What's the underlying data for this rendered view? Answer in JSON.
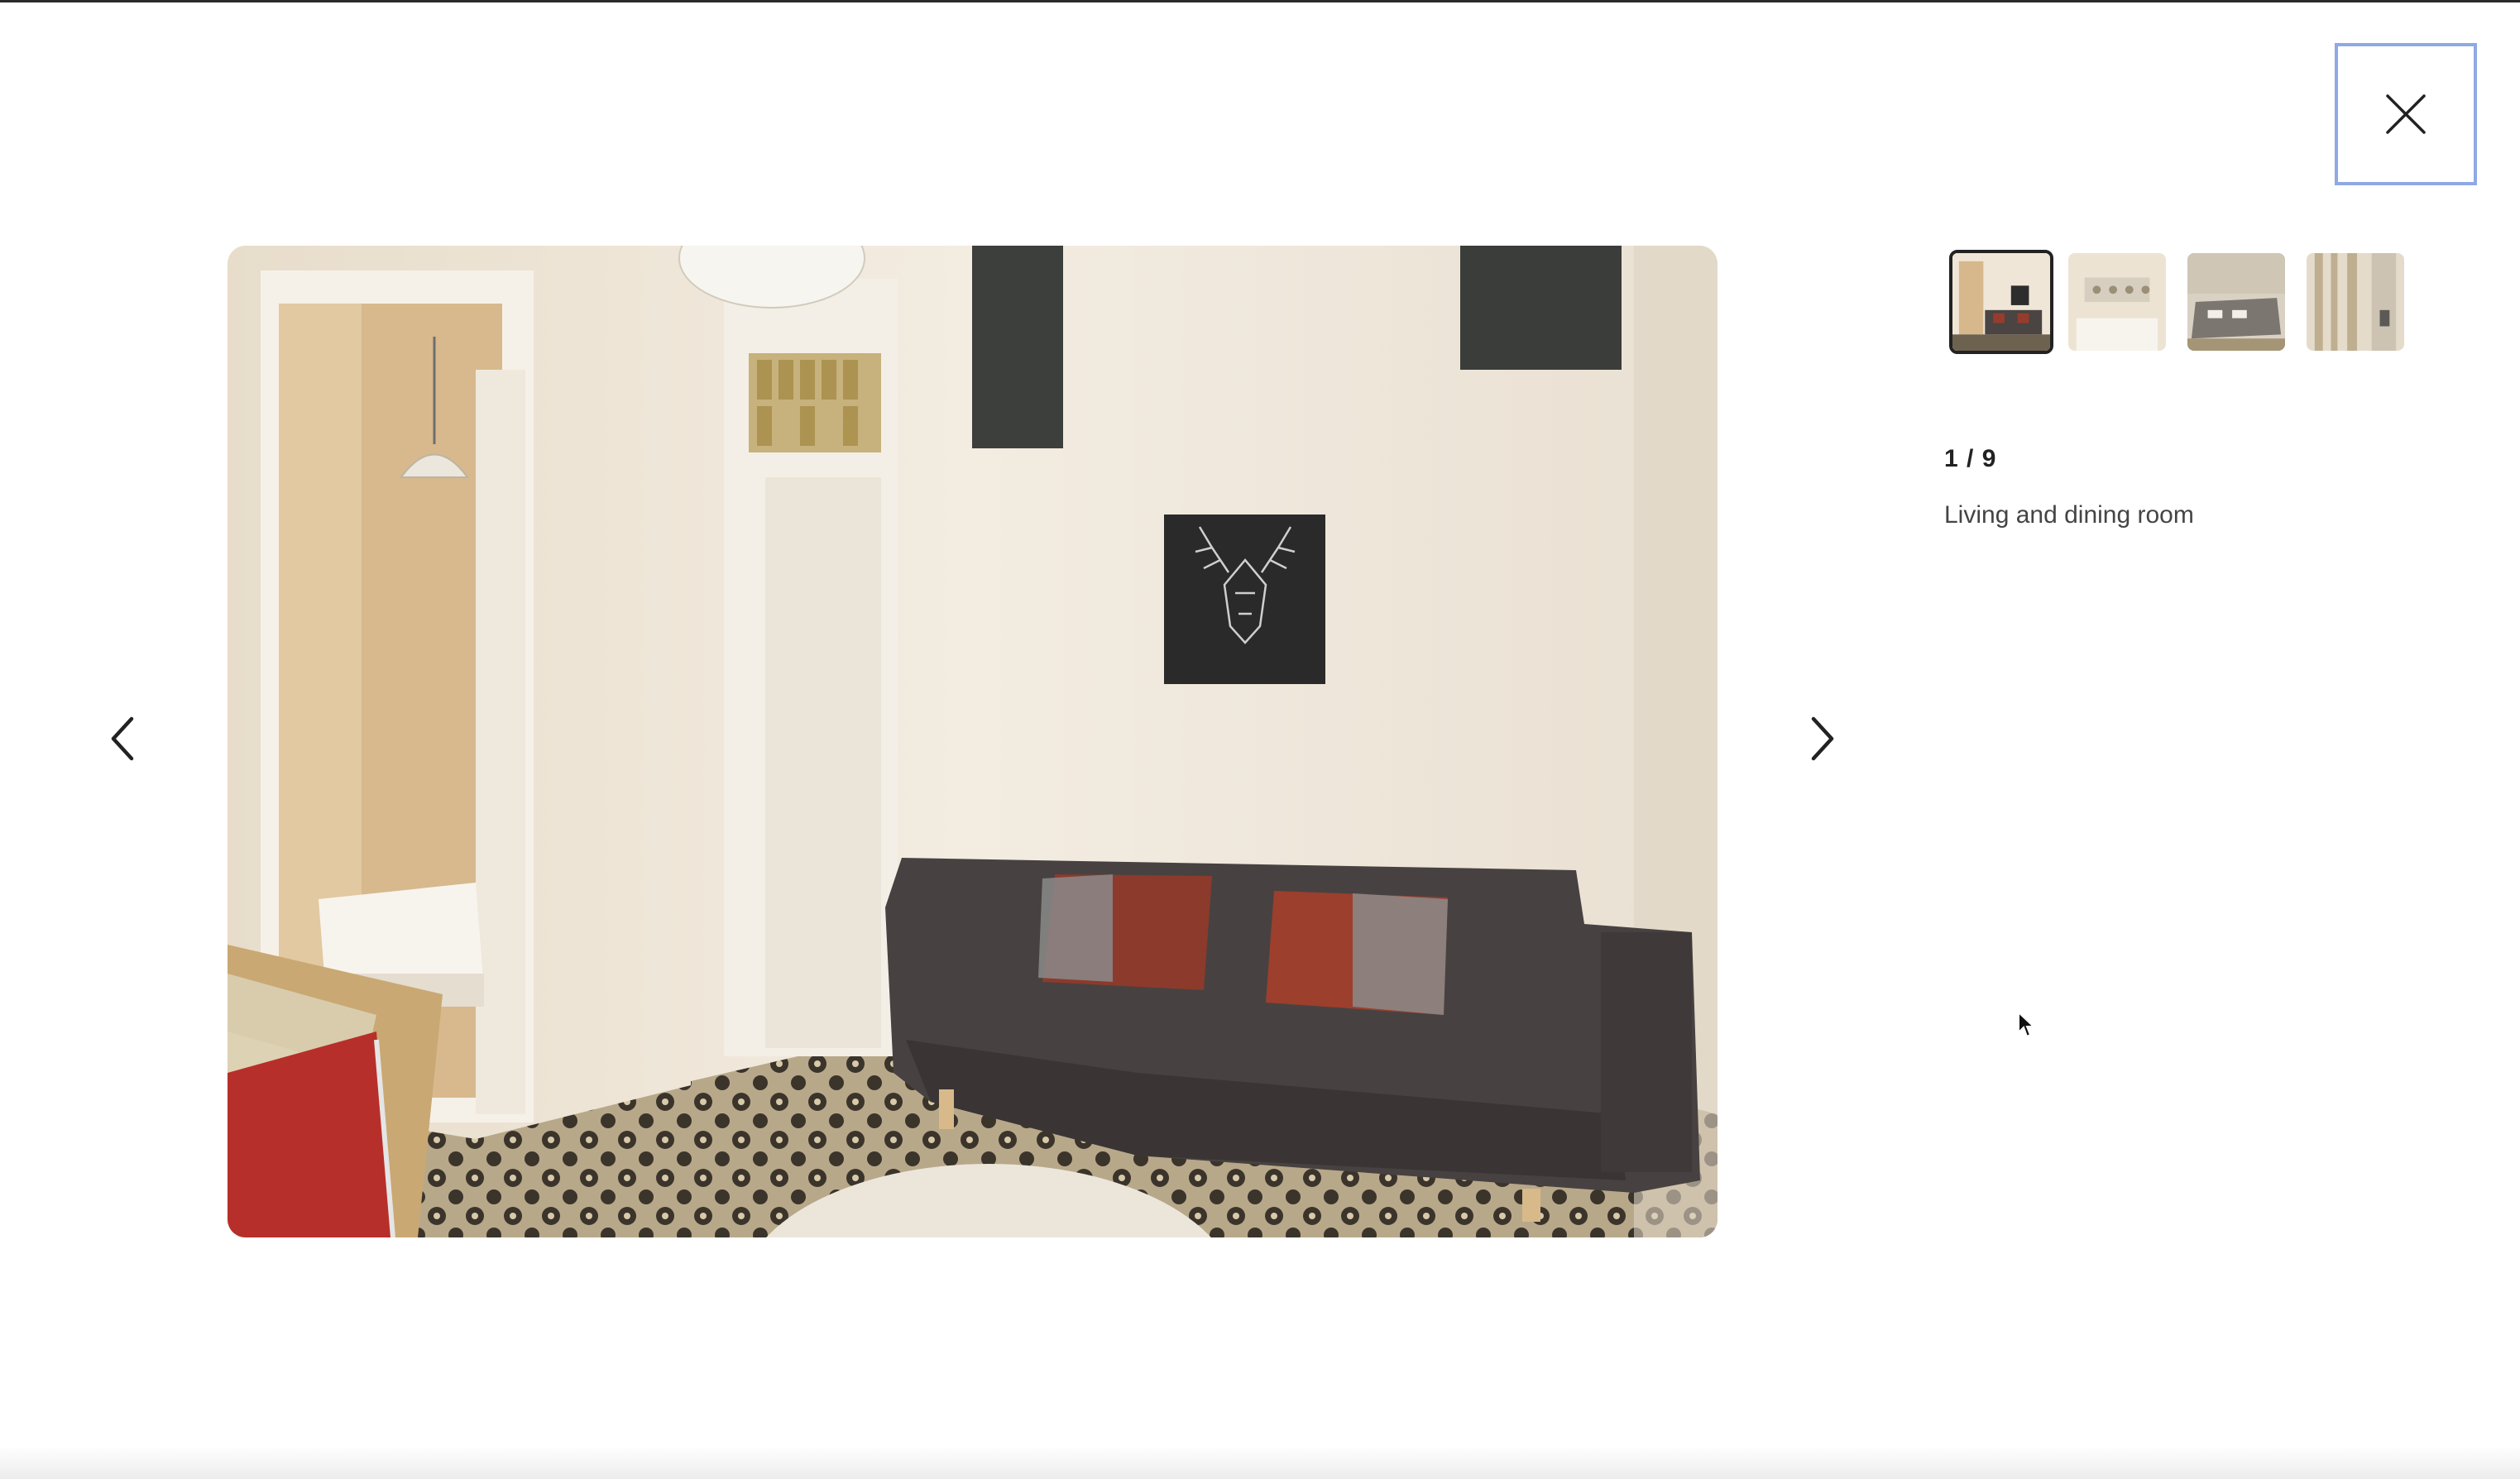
{
  "gallery": {
    "counter": "1 / 9",
    "caption": "Living and dining room",
    "close_label": "close",
    "prev_label": "previous photo",
    "next_label": "next photo",
    "thumbnails": [
      {
        "label": "Living and dining room",
        "active": true
      },
      {
        "label": "Photo 2",
        "active": false
      },
      {
        "label": "Photo 3",
        "active": false
      },
      {
        "label": "Photo 4",
        "active": false
      }
    ]
  },
  "icons": {
    "close": "close-icon",
    "prev": "chevron-left-icon",
    "next": "chevron-right-icon"
  },
  "colors": {
    "close_focus_ring": "#8fa9e6",
    "text": "#222222",
    "active_thumb_border": "#222222"
  }
}
